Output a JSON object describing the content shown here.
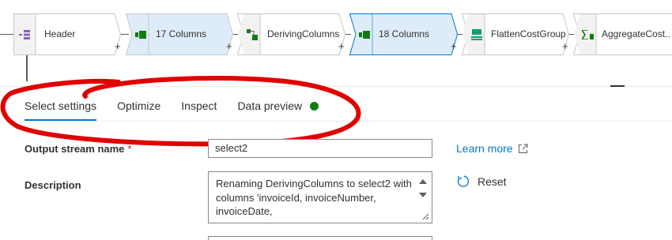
{
  "flow": {
    "nodes": [
      {
        "label": "Header",
        "icon": "source-header-icon"
      },
      {
        "label": "17 Columns",
        "icon": "columns-icon",
        "selected": true
      },
      {
        "label": "DerivingColumns",
        "icon": "derived-column-icon"
      },
      {
        "label": "18 Columns",
        "icon": "columns-icon",
        "selected": true
      },
      {
        "label": "FlattenCostGroup",
        "icon": "flatten-icon"
      },
      {
        "label": "AggregateCost...",
        "icon": "aggregate-icon"
      }
    ],
    "add_symbol": "+"
  },
  "tabs": {
    "items": [
      {
        "label": "Select settings",
        "active": true
      },
      {
        "label": "Optimize",
        "active": false
      },
      {
        "label": "Inspect",
        "active": false
      },
      {
        "label": "Data preview",
        "active": false,
        "status_dot_color": "#107c10"
      }
    ]
  },
  "form": {
    "output_stream_label": "Output stream name",
    "required_marker": "*",
    "output_stream_value": "select2",
    "description_label": "Description",
    "description_value": "Renaming DerivingColumns to select2 with columns 'invoiceId, invoiceNumber, invoiceDate,",
    "learn_more": "Learn more",
    "reset": "Reset"
  },
  "colors": {
    "accent": "#0078d4",
    "annotation": "#e00000",
    "selected_node_fill": "#deecf9",
    "status_green": "#107c10"
  }
}
